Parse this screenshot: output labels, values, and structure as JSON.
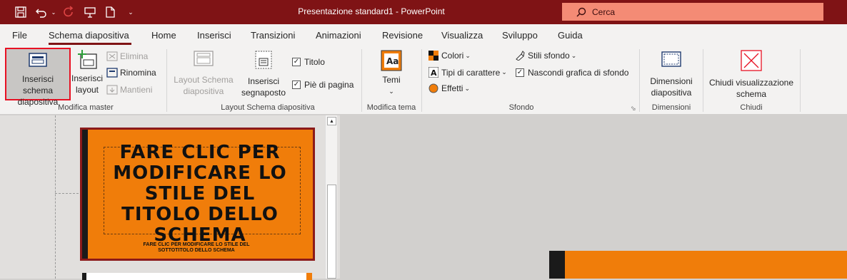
{
  "titlebar": {
    "title": "Presentazione standard1 - PowerPoint",
    "search_placeholder": "Cerca"
  },
  "tabs": [
    "File",
    "Schema diapositiva",
    "Home",
    "Inserisci",
    "Transizioni",
    "Animazioni",
    "Revisione",
    "Visualizza",
    "Sviluppo",
    "Guida"
  ],
  "ribbon": {
    "modifica_master": {
      "label": "Modifica master",
      "inserisci_schema": "Inserisci schema diapositiva",
      "inserisci_layout": "Inserisci layout",
      "elimina": "Elimina",
      "rinomina": "Rinomina",
      "mantieni": "Mantieni"
    },
    "layout_schema": {
      "label": "Layout Schema diapositiva",
      "layout_schema_btn": "Layout Schema diapositiva",
      "inserisci_segnaposto": "Inserisci segnaposto",
      "titolo": "Titolo",
      "pie_di_pagina": "Piè di pagina"
    },
    "modifica_tema": {
      "label": "Modifica tema",
      "temi": "Temi"
    },
    "sfondo": {
      "label": "Sfondo",
      "colori": "Colori",
      "tipi_carattere": "Tipi di carattere",
      "effetti": "Effetti",
      "stili_sfondo": "Stili sfondo",
      "nascondi": "Nascondi grafica di sfondo"
    },
    "dimensioni": {
      "label": "Dimensioni",
      "btn": "Dimensioni diapositiva"
    },
    "chiudi": {
      "label": "Chiudi",
      "btn": "Chiudi visualizzazione schema"
    }
  },
  "slide": {
    "title": "FARE CLIC PER MODIFICARE LO STILE DEL TITOLO DELLO SCHEMA",
    "subtitle": "FARE CLIC PER MODIFICARE LO STILE DEL SOTTOTITOLO DELLO SCHEMA"
  },
  "colors": {
    "titlebar": "#7f1315",
    "accent": "#f07d0a",
    "search": "#f48b75"
  }
}
